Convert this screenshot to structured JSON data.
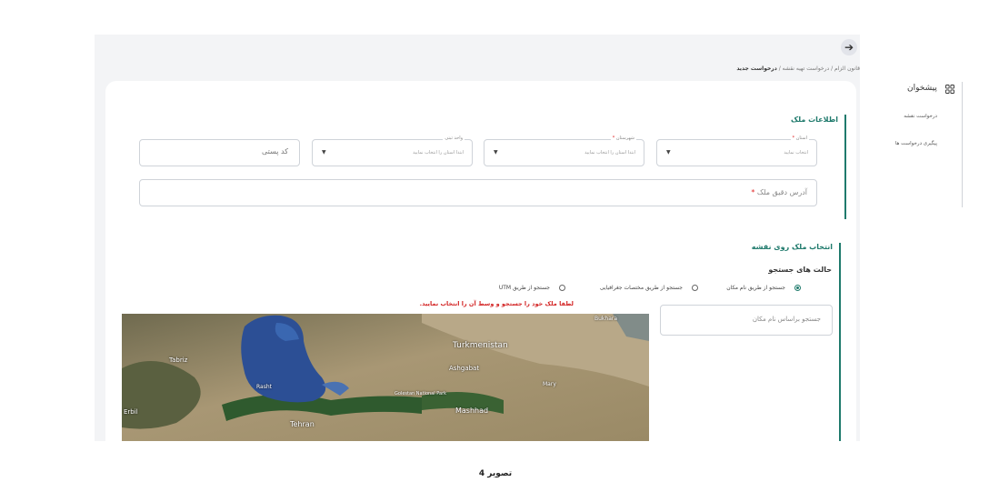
{
  "sidebar": {
    "title": "پیشخوان",
    "items": [
      {
        "label": "درخواست نقشه"
      },
      {
        "label": "پیگیری درخواست ها"
      }
    ]
  },
  "header": {
    "breadcrumb_prefix": "قانون الزام / درخواست تهیه نقشه / ",
    "breadcrumb_current": "درخواست جدید"
  },
  "property_info": {
    "title": "اطلاعات ملک",
    "fields": {
      "province": {
        "label": "استان",
        "value": "انتخاب نمایید"
      },
      "city": {
        "label": "شهرستان",
        "value": "ابتدا استان را انتخاب نمایید"
      },
      "unit": {
        "label": "واحد ثبتی",
        "value": "ابتدا استان را انتخاب نمایید"
      },
      "postal_code": {
        "placeholder": "کد پستی"
      },
      "address": {
        "label": "آدرس دقیق ملک"
      }
    }
  },
  "map_section": {
    "title": "انتخاب ملک روی نقشه",
    "search_mode_title": "حالت های جستجو",
    "options": [
      {
        "label": "جستجو از طریق نام مکان",
        "selected": true
      },
      {
        "label": "جستجو از طریق مختصات جغرافیایی",
        "selected": false
      },
      {
        "label": "جستجو از طریق UTM",
        "selected": false
      }
    ],
    "warning": "لطفا ملک خود را جستجو و وسط آن را انتخاب نمایید.",
    "search_placeholder": "جستجو براساس نام مکان",
    "map_labels": {
      "turkmenistan": "Turkmenistan",
      "ashgabat": "Ashgabat",
      "tehran": "Tehran",
      "mashhad": "Mashhad",
      "tabriz": "Tabriz",
      "rasht": "Rasht",
      "erbil": "Erbil",
      "bukhara": "Bukhara",
      "golestan": "Golestan National Park",
      "mary": "Mary"
    }
  },
  "caption": "تصویر 4",
  "colors": {
    "accent": "#1f7a6c",
    "required": "#e02424",
    "warning": "#d32424"
  }
}
